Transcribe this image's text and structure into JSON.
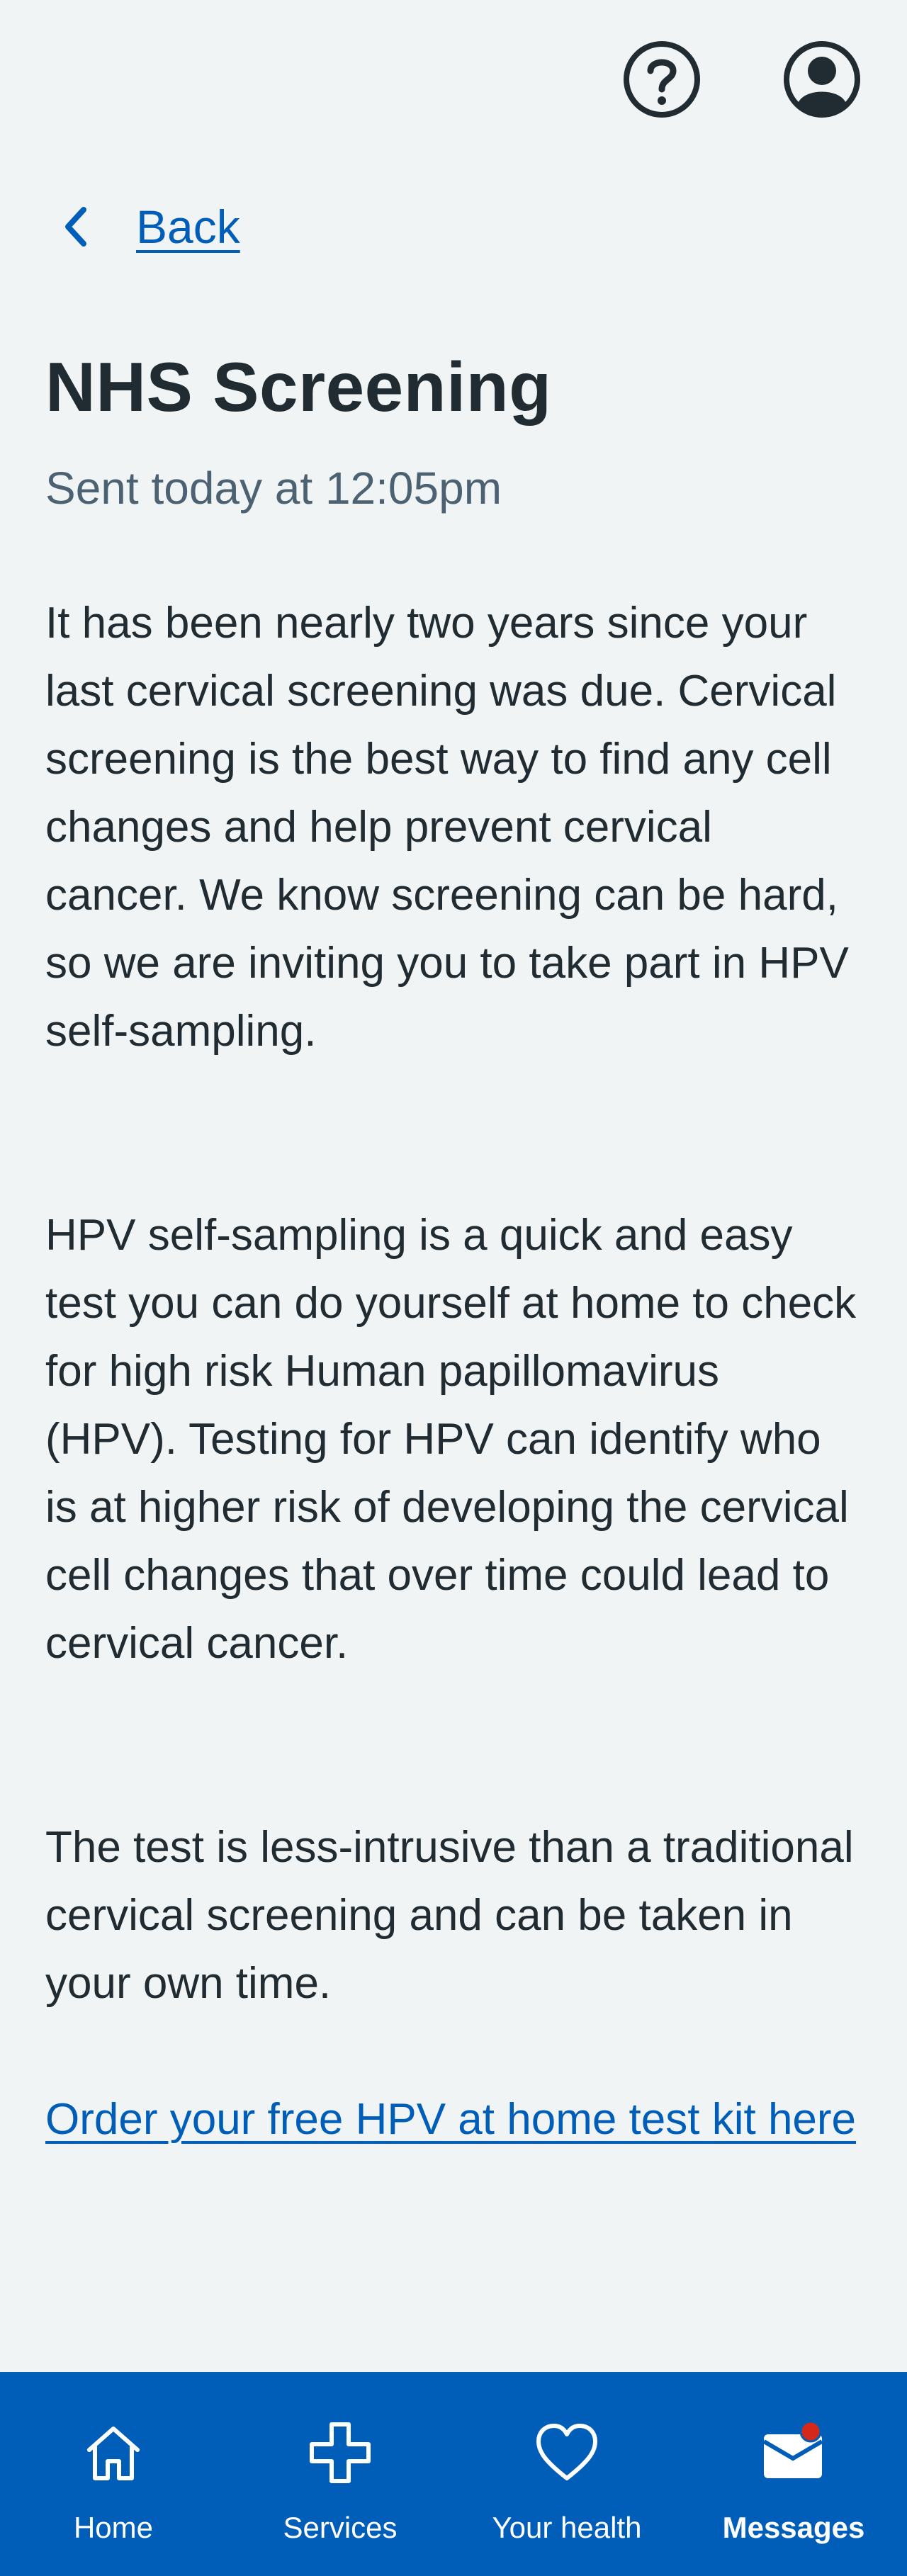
{
  "header": {
    "help_icon": "help-circle-icon",
    "account_icon": "user-account-icon"
  },
  "back": {
    "label": "Back",
    "icon": "chevron-left-icon"
  },
  "message": {
    "title": "NHS Screening",
    "sent": "Sent today at 12:05pm",
    "paragraphs": [
      "It has been nearly two years since your last cervical screening was due. Cervical screening is the best way to find any cell changes and help prevent cervical cancer. We know screening can be hard, so we are inviting you to take part in HPV self-sampling.",
      "HPV self-sampling is a quick and easy test you can do yourself at home to check for high risk Human papillomavirus (HPV). Testing for HPV can identify who is at higher risk of developing the cervical cell changes that over time could lead to cervical cancer.",
      "The test is less-intrusive than a traditional cervical screening and can be taken in your own time."
    ],
    "link": "Order your free HPV at home test kit here"
  },
  "nav": {
    "items": [
      {
        "label": "Home",
        "icon": "home-icon",
        "active": false
      },
      {
        "label": "Services",
        "icon": "plus-cross-icon",
        "active": false
      },
      {
        "label": "Your health",
        "icon": "heart-icon",
        "active": false
      },
      {
        "label": "Messages",
        "icon": "envelope-icon",
        "active": true,
        "badge": "unread-dot"
      }
    ]
  },
  "colors": {
    "nhs_blue": "#005eb8",
    "background": "#f0f4f5",
    "text": "#212b32",
    "secondary_text": "#4c6272",
    "badge": "#d5281b"
  }
}
